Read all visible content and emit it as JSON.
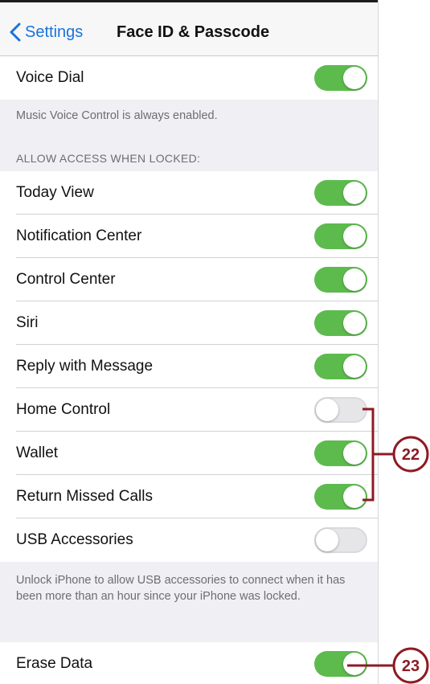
{
  "nav": {
    "back_label": "Settings",
    "title": "Face ID & Passcode"
  },
  "voice_dial": {
    "label": "Voice Dial",
    "on": true
  },
  "music_note": "Music Voice Control is always enabled.",
  "locked_section": {
    "header": "ALLOW ACCESS WHEN LOCKED:",
    "items": [
      {
        "label": "Today View",
        "on": true
      },
      {
        "label": "Notification Center",
        "on": true
      },
      {
        "label": "Control Center",
        "on": true
      },
      {
        "label": "Siri",
        "on": true
      },
      {
        "label": "Reply with Message",
        "on": true
      },
      {
        "label": "Home Control",
        "on": false
      },
      {
        "label": "Wallet",
        "on": true
      },
      {
        "label": "Return Missed Calls",
        "on": true
      },
      {
        "label": "USB Accessories",
        "on": false
      }
    ]
  },
  "usb_note": "Unlock iPhone to allow USB accessories to connect when it has been more than an hour since your iPhone was locked.",
  "erase_data": {
    "label": "Erase Data",
    "on": true
  },
  "callouts": {
    "bracket": "22",
    "erase": "23"
  },
  "colors": {
    "toggle_on": "#5dbb4e",
    "toggle_off": "#e6e6e9",
    "link_blue": "#1a73d9",
    "callout": "#8e1b23",
    "group_bg": "#efeff4"
  }
}
